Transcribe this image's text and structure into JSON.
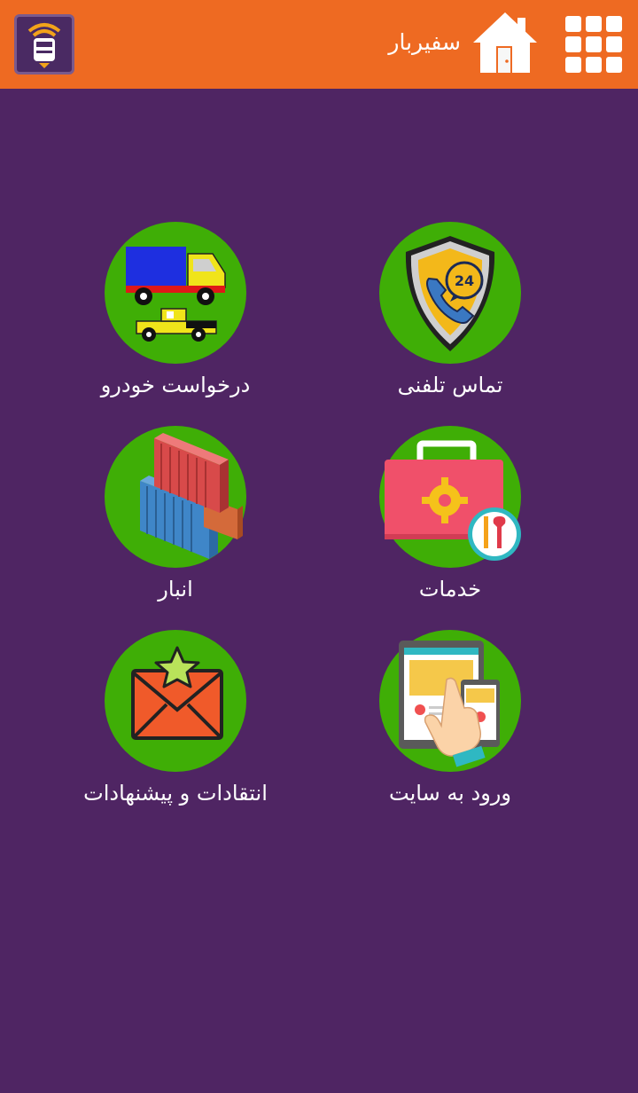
{
  "header": {
    "title": "سفیربار",
    "logo_icon": "truck-signal-icon",
    "home_icon": "home-icon",
    "menu_icon": "grid-menu-icon"
  },
  "colors": {
    "header_bg": "#ee6a22",
    "page_bg": "#4f2563",
    "tile_circle": "#3fae06",
    "label": "#ffffff"
  },
  "tiles": [
    {
      "label": "تماس تلفنی",
      "icon": "phone-support-24-icon"
    },
    {
      "label": "درخواست خودرو",
      "icon": "trucks-icon"
    },
    {
      "label": "خدمات",
      "icon": "toolbox-icon"
    },
    {
      "label": "انبار",
      "icon": "containers-icon"
    },
    {
      "label": "ورود به سایت",
      "icon": "website-touch-icon"
    },
    {
      "label": "انتقادات و پیشنهادات",
      "icon": "envelope-star-icon"
    }
  ]
}
